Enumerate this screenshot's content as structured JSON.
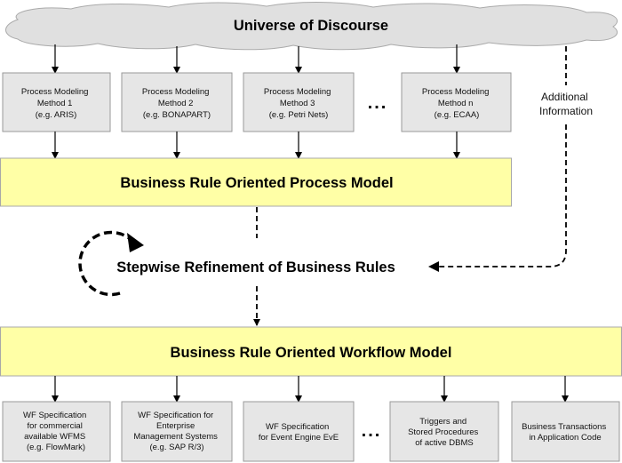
{
  "cloud": {
    "title": "Universe of Discourse"
  },
  "methods": [
    {
      "lines": [
        "Process Modeling",
        "Method 1",
        "(e.g. ARIS)"
      ]
    },
    {
      "lines": [
        "Process Modeling",
        "Method 2",
        "(e.g. BONAPART)"
      ]
    },
    {
      "lines": [
        "Process Modeling",
        "Method 3",
        "(e.g. Petri Nets)"
      ]
    },
    {
      "lines": [
        "Process Modeling",
        "Method n",
        "(e.g. ECAA)"
      ]
    }
  ],
  "methods_ellipsis": "...",
  "additional_info": {
    "lines": [
      "Additional",
      "Information"
    ]
  },
  "process_model": {
    "title": "Business Rule Oriented Process Model"
  },
  "refinement": {
    "title": "Stepwise Refinement of Business Rules"
  },
  "workflow_model": {
    "title": "Business Rule Oriented Workflow Model"
  },
  "targets": [
    {
      "lines": [
        "WF Specification",
        "for commercial",
        "available WFMS",
        "(e.g. FlowMark)"
      ]
    },
    {
      "lines": [
        "WF Specification for",
        "Enterprise",
        "Management Systems",
        "(e.g. SAP R/3)"
      ]
    },
    {
      "lines": [
        "WF Specification",
        "for Event Engine EvE"
      ]
    },
    {
      "lines": [
        "Triggers and",
        "Stored Procedures",
        "of active DBMS"
      ]
    },
    {
      "lines": [
        "Business Transactions",
        "in Application Code"
      ]
    }
  ],
  "targets_ellipsis": "...",
  "colors": {
    "model_fill": "#ffffa6",
    "box_fill": "#e6e6e6",
    "cloud_fill": "#e0e0e0"
  }
}
